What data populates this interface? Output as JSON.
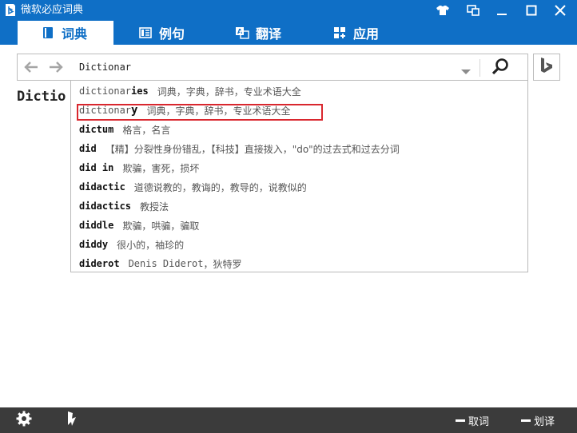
{
  "window": {
    "title": "微软必应词典"
  },
  "tabs": [
    {
      "label": "词典",
      "icon": "book-icon",
      "active": true
    },
    {
      "label": "例句",
      "icon": "sentences-icon",
      "active": false
    },
    {
      "label": "翻译",
      "icon": "translate-icon",
      "active": false
    },
    {
      "label": "应用",
      "icon": "apps-icon",
      "active": false
    }
  ],
  "search": {
    "value": "Dictionar"
  },
  "background_word": "Dictio",
  "suggestions": [
    {
      "prefix": "dictionar",
      "suffix": "ies",
      "definition": "词典，字典，辞书，专业术语大全",
      "highlighted": false
    },
    {
      "prefix": "dictionar",
      "suffix": "y",
      "definition": "词典，字典，辞书，专业术语大全",
      "highlighted": true
    },
    {
      "prefix": "",
      "suffix": "dictum",
      "definition": "格言，名言",
      "highlighted": false
    },
    {
      "prefix": "",
      "suffix": "did",
      "definition": "【精】分裂性身份错乱，【科技】直接拨入，\"do\"的过去式和过去分词",
      "highlighted": false
    },
    {
      "prefix": "",
      "suffix": "did in",
      "definition": "欺骗，害死，损坏",
      "highlighted": false
    },
    {
      "prefix": "",
      "suffix": "didactic",
      "definition": "道德说教的，教诲的，教导的，说教似的",
      "highlighted": false
    },
    {
      "prefix": "",
      "suffix": "didactics",
      "definition": "教授法",
      "highlighted": false
    },
    {
      "prefix": "",
      "suffix": "diddle",
      "definition": "欺骗，哄骗，骗取",
      "highlighted": false
    },
    {
      "prefix": "",
      "suffix": "diddy",
      "definition": "很小的，袖珍的",
      "highlighted": false
    },
    {
      "prefix": "",
      "suffix": "diderot",
      "definition_en": "Denis Diderot",
      "definition": "，狄特罗",
      "highlighted": false
    }
  ],
  "bottom": {
    "word_capture_label": "取词",
    "word_select_label": "划译"
  },
  "colors": {
    "accent": "#0f6fc6",
    "bottom_bar": "#3b3b3b",
    "highlight_border": "#d9272e"
  }
}
